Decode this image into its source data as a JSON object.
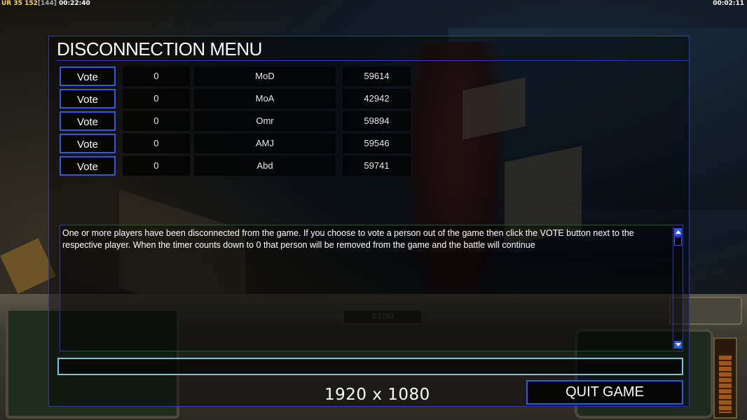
{
  "status_bar": {
    "left_prefix": "UR",
    "num1": "35",
    "fps": "152",
    "fps_bracket": "[144]",
    "elapsed": "00:22:40",
    "clock": "00:02:11"
  },
  "dialog": {
    "title": "DISCONNECTION MENU",
    "vote_label": "Vote",
    "players": [
      {
        "votes": "0",
        "name": "MoD",
        "ping": "59614"
      },
      {
        "votes": "0",
        "name": "MoA",
        "ping": "42942"
      },
      {
        "votes": "0",
        "name": "Omr",
        "ping": "59894"
      },
      {
        "votes": "0",
        "name": "AMJ",
        "ping": "59546"
      },
      {
        "votes": "0",
        "name": "Abd",
        "ping": "59741"
      }
    ],
    "message": "One or more players have been disconnected from the game. If you choose to vote a person out of the game then click the VOTE button next to the respective player. When the timer counts down to 0 that person will be removed from the game and the battle will continue",
    "chat_value": "",
    "quit_label": "QUIT GAME"
  },
  "overlay_resolution": "1920 x 1080",
  "hud": {
    "money": "$ 1750"
  }
}
